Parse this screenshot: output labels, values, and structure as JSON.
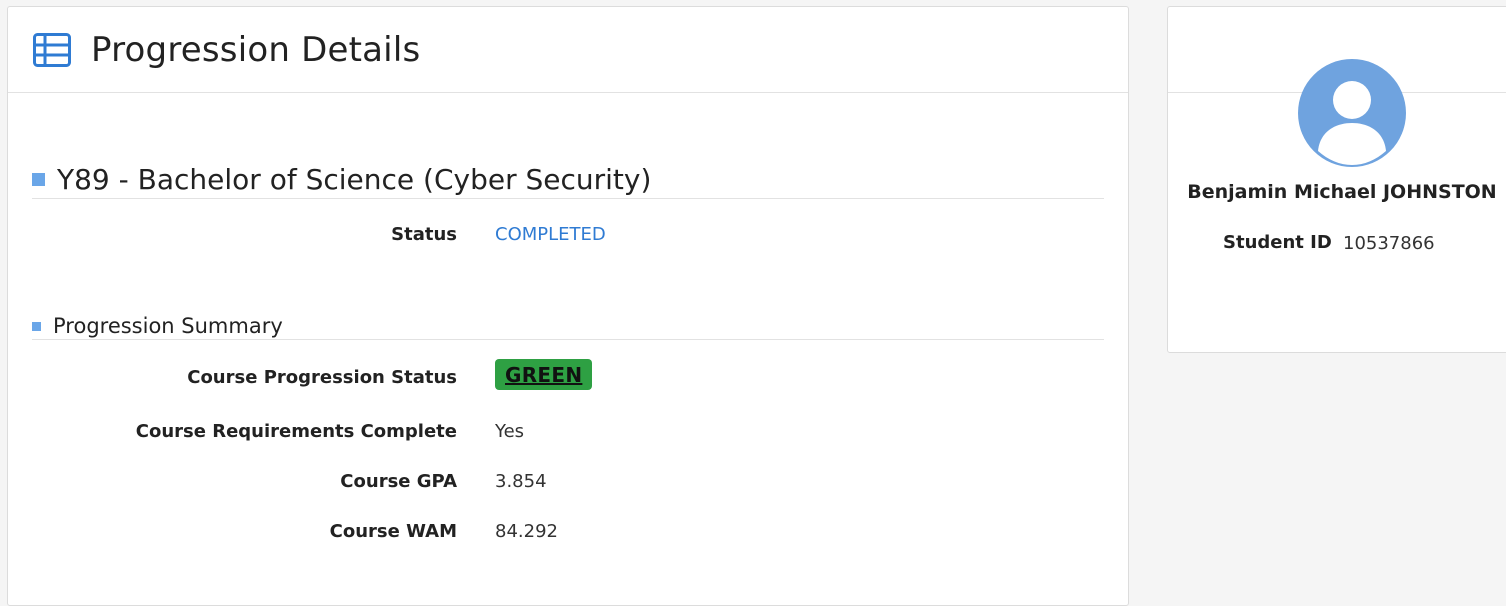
{
  "header": {
    "title": "Progression Details",
    "icon": "table-icon"
  },
  "course": {
    "heading": "Y89 - Bachelor of Science (Cyber Security)",
    "status_label": "Status",
    "status_value": "COMPLETED"
  },
  "summary": {
    "heading": "Progression Summary",
    "rows": [
      {
        "label": "Course Progression Status",
        "value": "GREEN"
      },
      {
        "label": "Course Requirements Complete",
        "value": "Yes"
      },
      {
        "label": "Course GPA",
        "value": "3.854"
      },
      {
        "label": "Course WAM",
        "value": "84.292"
      }
    ]
  },
  "profile": {
    "name": "Benjamin Michael JOHNSTON",
    "student_id_label": "Student ID",
    "student_id_value": "10537866",
    "avatar_icon": "user-avatar-icon"
  },
  "colors": {
    "accent_blue": "#2f7bd3",
    "bullet_blue": "#6aa6e8",
    "badge_green": "#2ea043",
    "avatar_blue": "#6fa3df"
  }
}
